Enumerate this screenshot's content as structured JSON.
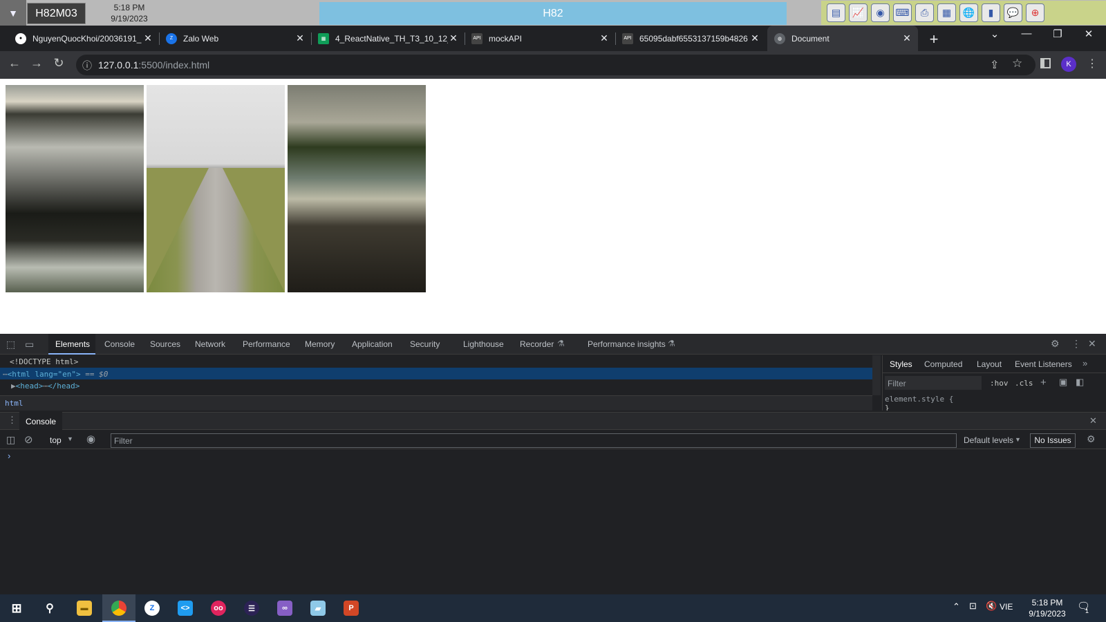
{
  "remote_bar": {
    "host": "H82M03",
    "time": "5:18 PM",
    "date": "9/19/2023",
    "session_title": "H82"
  },
  "tabs": [
    {
      "title": "NguyenQuocKhoi/20036191_",
      "favicon": "github-icon"
    },
    {
      "title": "Zalo Web",
      "favicon": "zalo-icon"
    },
    {
      "title": "4_ReactNative_TH_T3_10_12_",
      "favicon": "sheets-icon"
    },
    {
      "title": "mockAPI",
      "favicon": "mockapi-icon"
    },
    {
      "title": "65095dabf6553137159b4826",
      "favicon": "mockapi-icon"
    },
    {
      "title": "Document",
      "favicon": "globe-icon",
      "active": true
    }
  ],
  "address": {
    "host": "127.0.0.1",
    "path": ":5500/index.html"
  },
  "profile_initial": "K",
  "page": {
    "images": [
      {
        "description": "frosty field at dawn"
      },
      {
        "description": "gravel path between bare trees"
      },
      {
        "description": "mountain river with rocks"
      }
    ]
  },
  "devtools": {
    "tabs": [
      "Elements",
      "Console",
      "Sources",
      "Network",
      "Performance",
      "Memory",
      "Application",
      "Security",
      "Lighthouse",
      "Recorder",
      "Performance insights"
    ],
    "dom": {
      "line1": "<!DOCTYPE html>",
      "line2": "<html lang=\"en\">",
      "line2_suffix": "== $0",
      "line3": "<head>",
      "line3_end": "</head>"
    },
    "breadcrumb": "html",
    "styles_tabs": [
      "Styles",
      "Computed",
      "Layout",
      "Event Listeners"
    ],
    "styles_filter_placeholder": "Filter",
    "hov": ":hov",
    "cls": ".cls",
    "element_style": "element.style {",
    "element_style_end": "}",
    "drawer_tab": "Console",
    "context": "top",
    "console_filter_placeholder": "Filter",
    "levels": "Default levels",
    "issues": "No Issues"
  },
  "taskbar": {
    "time": "5:18 PM",
    "date": "9/19/2023",
    "language": "VIE",
    "notification_count": "1"
  },
  "colors": {
    "accent": "#8ab4f8",
    "devtools_bg": "#202124",
    "session_bar": "#7ec0e0"
  }
}
